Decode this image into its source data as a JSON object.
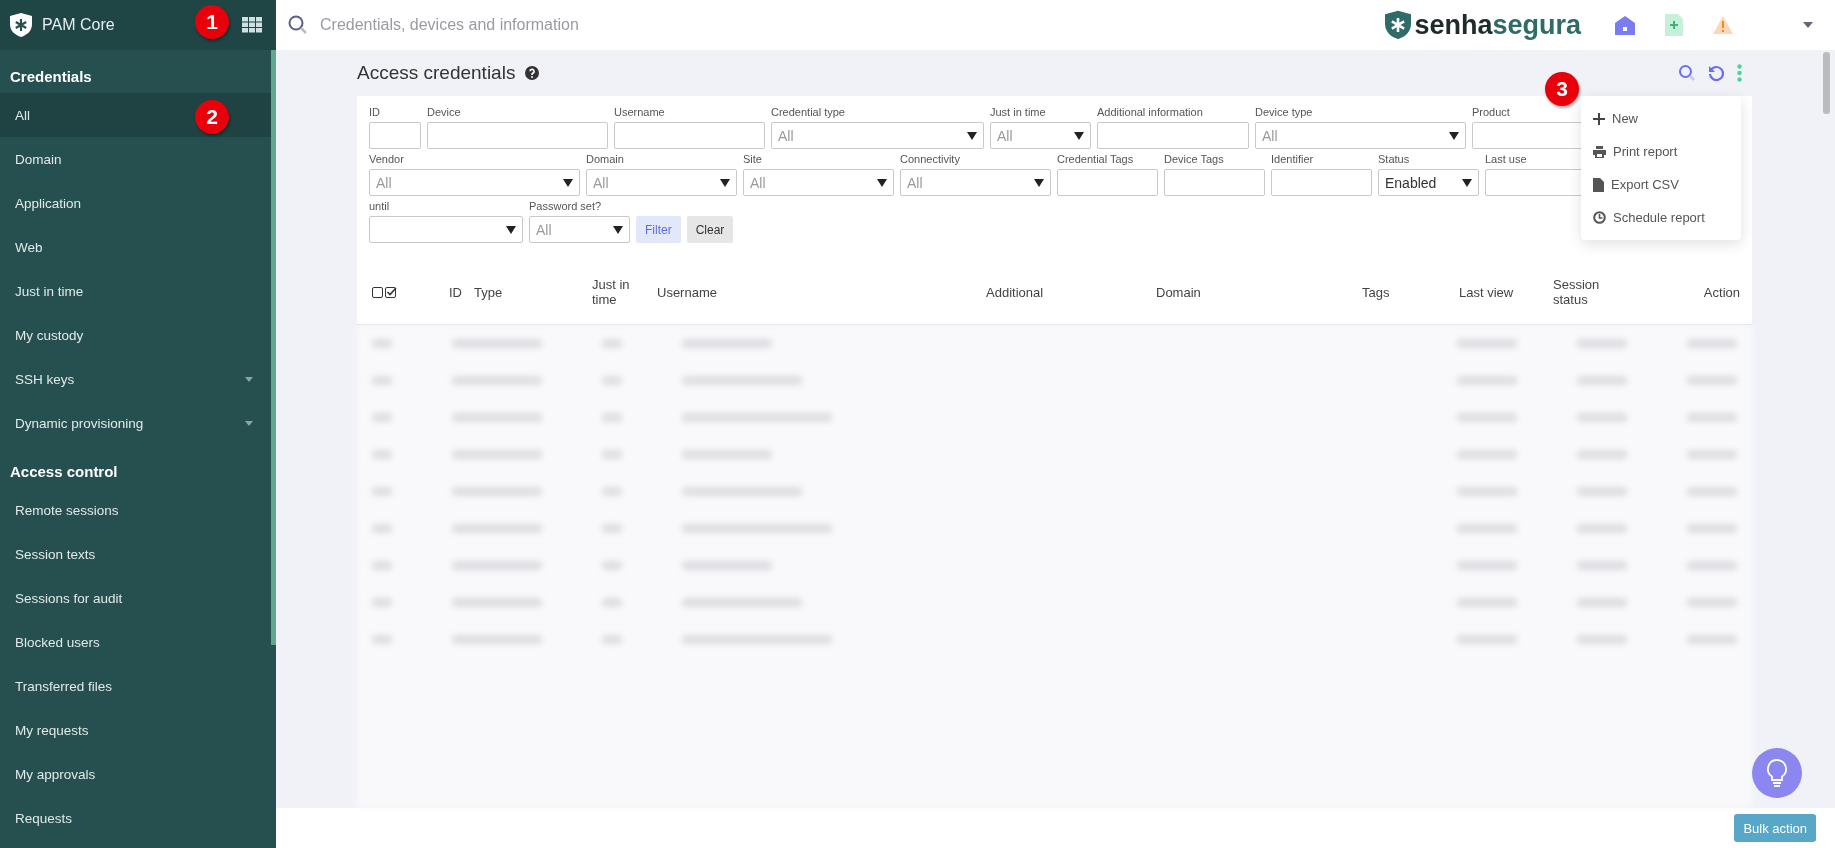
{
  "app": {
    "title": "PAM Core"
  },
  "search": {
    "placeholder": "Credentials, devices and information"
  },
  "logo_text": [
    "senha",
    "segura"
  ],
  "sidebar": {
    "sections": [
      {
        "title": "Credentials",
        "items": [
          {
            "label": "All",
            "selected": true,
            "expandable": false
          },
          {
            "label": "Domain",
            "selected": false,
            "expandable": false
          },
          {
            "label": "Application",
            "selected": false,
            "expandable": false
          },
          {
            "label": "Web",
            "selected": false,
            "expandable": false
          },
          {
            "label": "Just in time",
            "selected": false,
            "expandable": false
          },
          {
            "label": "My custody",
            "selected": false,
            "expandable": false
          },
          {
            "label": "SSH keys",
            "selected": false,
            "expandable": true
          },
          {
            "label": "Dynamic provisioning",
            "selected": false,
            "expandable": true
          }
        ]
      },
      {
        "title": "Access control",
        "items": [
          {
            "label": "Remote sessions",
            "selected": false,
            "expandable": false
          },
          {
            "label": "Session texts",
            "selected": false,
            "expandable": false
          },
          {
            "label": "Sessions for audit",
            "selected": false,
            "expandable": false
          },
          {
            "label": "Blocked users",
            "selected": false,
            "expandable": false
          },
          {
            "label": "Transferred files",
            "selected": false,
            "expandable": false
          },
          {
            "label": "My requests",
            "selected": false,
            "expandable": false
          },
          {
            "label": "My approvals",
            "selected": false,
            "expandable": false
          },
          {
            "label": "Requests",
            "selected": false,
            "expandable": false
          }
        ]
      }
    ]
  },
  "page_title": "Access credentials",
  "filters": [
    {
      "label": "ID",
      "kind": "text"
    },
    {
      "label": "Device",
      "kind": "text"
    },
    {
      "label": "Username",
      "kind": "text"
    },
    {
      "label": "Credential type",
      "kind": "select",
      "placeholder": "All"
    },
    {
      "label": "Just in time",
      "kind": "select",
      "placeholder": "All"
    },
    {
      "label": "Additional information",
      "kind": "text"
    },
    {
      "label": "Device type",
      "kind": "select",
      "placeholder": "All"
    },
    {
      "label": "Product",
      "kind": "text"
    },
    {
      "label": "Vendor",
      "kind": "select",
      "placeholder": "All"
    },
    {
      "label": "Domain",
      "kind": "select",
      "placeholder": "All"
    },
    {
      "label": "Site",
      "kind": "select",
      "placeholder": "All"
    },
    {
      "label": "Connectivity",
      "kind": "select",
      "placeholder": "All"
    },
    {
      "label": "Credential Tags",
      "kind": "text"
    },
    {
      "label": "Device Tags",
      "kind": "text"
    },
    {
      "label": "Identifier",
      "kind": "text"
    },
    {
      "label": "Status",
      "kind": "select",
      "value": "Enabled"
    },
    {
      "label": "Last use",
      "kind": "text"
    },
    {
      "label": "until",
      "kind": "select"
    },
    {
      "label": "Password set?",
      "kind": "select",
      "placeholder": "All"
    }
  ],
  "filter_buttons": [
    {
      "label": "Filter",
      "kind": "primary"
    },
    {
      "label": "Clear",
      "kind": "secondary"
    }
  ],
  "table": {
    "columns": [
      "ID",
      "Type",
      "Just in time",
      "Username",
      "Additional",
      "Domain",
      "Tags",
      "Last view",
      "Session status",
      "Action"
    ]
  },
  "actions_menu": {
    "items": [
      {
        "label": "New"
      },
      {
        "label": "Print report"
      },
      {
        "label": "Export CSV"
      },
      {
        "label": "Schedule report"
      }
    ]
  },
  "bulk_action": "Bulk action",
  "markers": [
    "1",
    "2",
    "3"
  ]
}
